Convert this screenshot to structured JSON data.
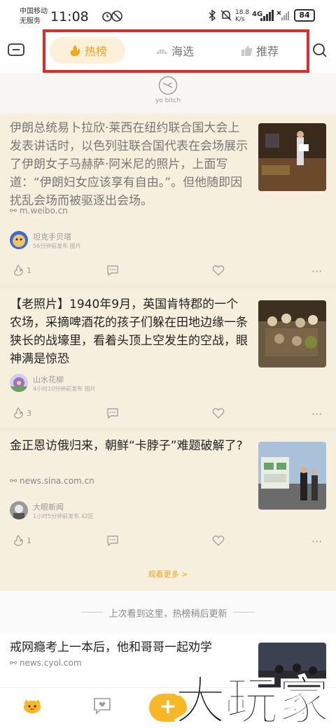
{
  "status_bar": {
    "carrier_line1": "中国移动",
    "carrier_line2": "无服务",
    "time": "11:08",
    "net_speed_value": "18.8",
    "net_speed_unit": "K/s",
    "network": "4G",
    "battery": "84"
  },
  "header": {
    "tabs": [
      {
        "label": "热榜",
        "icon": "flame-icon",
        "active": true
      },
      {
        "label": "海选",
        "icon": "shell-icon",
        "active": false
      },
      {
        "label": "推荐",
        "icon": "thumbs-up-icon",
        "active": false
      }
    ]
  },
  "yo": {
    "label": "yo bitch"
  },
  "feed": {
    "cards": [
      {
        "title": "伊朗总统易卜拉欣·莱西在纽约联合国大会上发表讲话时，以色列驻联合国代表在会场展示了伊朗女子马赫萨·阿米尼的照片，上面写道：“伊朗妇女应该享有自由。”。但他随即因扰乱会场而被驱逐出会场。",
        "source": "m.weibo.cn",
        "author": "坦克手贝塔",
        "meta": "56分钟前发布   图片",
        "likes": "1",
        "comments": ""
      },
      {
        "title": "【老照片】1940年9月，英国肯特郡的一个农场，采摘啤酒花的孩子们躲在田地边缘一条狭长的战壕里，看着头顶上空发生的空战，眼神满是惊恐",
        "source": "",
        "author": "山水花柳",
        "meta": "4小时10分钟前发布   图片",
        "likes": "3",
        "comments": ""
      },
      {
        "title": "金正恩访俄归来，朝鲜“卡脖子”难题破解了?",
        "source": "news.sina.com.cn",
        "author": "大眼新闻",
        "meta": "1小时5分钟前发布   42区",
        "likes": "1",
        "comments": ""
      }
    ],
    "more_label": "观看更多 >"
  },
  "notice": {
    "text": "上次看到这里，热榜稍后更新"
  },
  "next_card": {
    "title": "戒网瘾考上一本后，他和哥哥一起劝学",
    "source": "news.cyol.com"
  },
  "bottom_nav": {
    "plus_label": "+",
    "watermark": "大玩家"
  },
  "colors": {
    "accent": "#f4a51d",
    "highlight_box": "#e12b2b",
    "card_bg": "#f7efdd"
  }
}
